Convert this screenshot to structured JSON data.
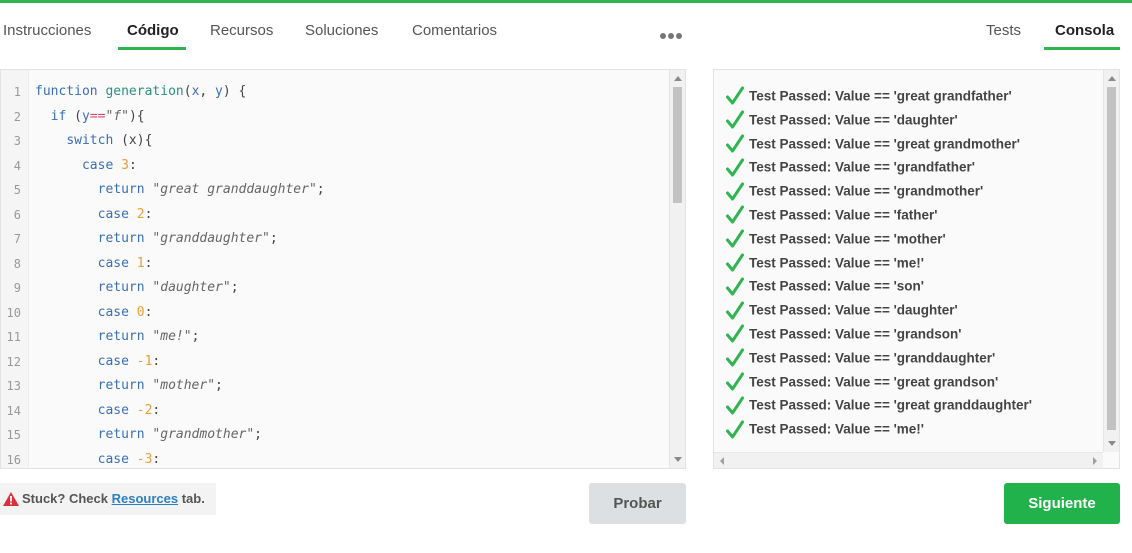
{
  "tabs_left": [
    {
      "label": "Instrucciones",
      "active": false
    },
    {
      "label": "Código",
      "active": true
    },
    {
      "label": "Recursos",
      "active": false
    },
    {
      "label": "Soluciones",
      "active": false
    },
    {
      "label": "Comentarios",
      "active": false
    }
  ],
  "more_icon": "more-horizontal-icon",
  "tabs_right": [
    {
      "label": "Tests",
      "active": false
    },
    {
      "label": "Consola",
      "active": true
    }
  ],
  "code_lines": [
    {
      "n": "1",
      "tokens": [
        [
          "kw",
          "function "
        ],
        [
          "fn",
          "generation"
        ],
        [
          "plain",
          "("
        ],
        [
          "kw",
          "x"
        ],
        [
          "plain",
          ", "
        ],
        [
          "kw",
          "y"
        ],
        [
          "plain",
          ") {"
        ]
      ]
    },
    {
      "n": "2",
      "tokens": [
        [
          "plain",
          "  "
        ],
        [
          "kw",
          "if "
        ],
        [
          "plain",
          "("
        ],
        [
          "kw",
          "y"
        ],
        [
          "op",
          "=="
        ],
        [
          "str",
          "\"f\""
        ],
        [
          "plain",
          "){"
        ]
      ]
    },
    {
      "n": "3",
      "tokens": [
        [
          "plain",
          "    "
        ],
        [
          "kw",
          "switch "
        ],
        [
          "plain",
          "(x){"
        ]
      ]
    },
    {
      "n": "4",
      "tokens": [
        [
          "plain",
          "      "
        ],
        [
          "kw",
          "case "
        ],
        [
          "num",
          "3"
        ],
        [
          "plain",
          ":"
        ]
      ]
    },
    {
      "n": "5",
      "tokens": [
        [
          "plain",
          "        "
        ],
        [
          "kw",
          "return "
        ],
        [
          "str",
          "\"great granddaughter\""
        ],
        [
          "plain",
          ";"
        ]
      ]
    },
    {
      "n": "6",
      "tokens": [
        [
          "plain",
          "        "
        ],
        [
          "kw",
          "case "
        ],
        [
          "num",
          "2"
        ],
        [
          "plain",
          ":"
        ]
      ]
    },
    {
      "n": "7",
      "tokens": [
        [
          "plain",
          "        "
        ],
        [
          "kw",
          "return "
        ],
        [
          "str",
          "\"granddaughter\""
        ],
        [
          "plain",
          ";"
        ]
      ]
    },
    {
      "n": "8",
      "tokens": [
        [
          "plain",
          "        "
        ],
        [
          "kw",
          "case "
        ],
        [
          "num",
          "1"
        ],
        [
          "plain",
          ":"
        ]
      ]
    },
    {
      "n": "9",
      "tokens": [
        [
          "plain",
          "        "
        ],
        [
          "kw",
          "return "
        ],
        [
          "str",
          "\"daughter\""
        ],
        [
          "plain",
          ";"
        ]
      ]
    },
    {
      "n": "10",
      "tokens": [
        [
          "plain",
          "        "
        ],
        [
          "kw",
          "case "
        ],
        [
          "num",
          "0"
        ],
        [
          "plain",
          ":"
        ]
      ]
    },
    {
      "n": "11",
      "tokens": [
        [
          "plain",
          "        "
        ],
        [
          "kw",
          "return "
        ],
        [
          "str",
          "\"me!\""
        ],
        [
          "plain",
          ";"
        ]
      ]
    },
    {
      "n": "12",
      "tokens": [
        [
          "plain",
          "        "
        ],
        [
          "kw",
          "case "
        ],
        [
          "num",
          "-1"
        ],
        [
          "plain",
          ":"
        ]
      ]
    },
    {
      "n": "13",
      "tokens": [
        [
          "plain",
          "        "
        ],
        [
          "kw",
          "return "
        ],
        [
          "str",
          "\"mother\""
        ],
        [
          "plain",
          ";"
        ]
      ]
    },
    {
      "n": "14",
      "tokens": [
        [
          "plain",
          "        "
        ],
        [
          "kw",
          "case "
        ],
        [
          "num",
          "-2"
        ],
        [
          "plain",
          ":"
        ]
      ]
    },
    {
      "n": "15",
      "tokens": [
        [
          "plain",
          "        "
        ],
        [
          "kw",
          "return "
        ],
        [
          "str",
          "\"grandmother\""
        ],
        [
          "plain",
          ";"
        ]
      ]
    },
    {
      "n": "16",
      "tokens": [
        [
          "plain",
          "        "
        ],
        [
          "kw",
          "case "
        ],
        [
          "num",
          "-3"
        ],
        [
          "plain",
          ":"
        ]
      ]
    }
  ],
  "console_lines": [
    "Test Passed: Value == 'great grandfather'",
    "Test Passed: Value == 'daughter'",
    "Test Passed: Value == 'great grandmother'",
    "Test Passed: Value == 'grandfather'",
    "Test Passed: Value == 'grandmother'",
    "Test Passed: Value == 'father'",
    "Test Passed: Value == 'mother'",
    "Test Passed: Value == 'me!'",
    "Test Passed: Value == 'son'",
    "Test Passed: Value == 'daughter'",
    "Test Passed: Value == 'grandson'",
    "Test Passed: Value == 'granddaughter'",
    "Test Passed: Value == 'great grandson'",
    "Test Passed: Value == 'great granddaughter'",
    "Test Passed: Value == 'me!'"
  ],
  "stuck": {
    "prefix": "Stuck? Check ",
    "link": "Resources",
    "suffix": " tab."
  },
  "buttons": {
    "run": "Probar",
    "next": "Siguiente"
  },
  "colors": {
    "accent": "#2fb450",
    "button_green": "#22b24c",
    "check": "#2fb450",
    "warning": "#d9303a"
  }
}
